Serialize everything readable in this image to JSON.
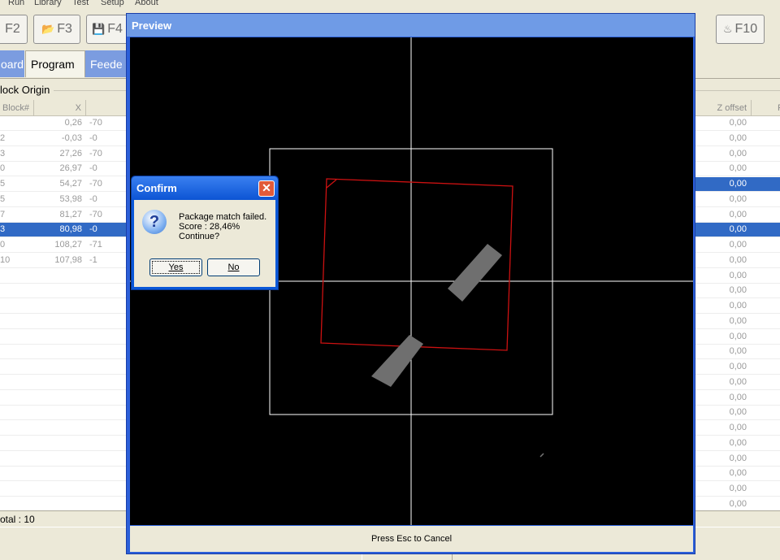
{
  "menu": [
    "Run",
    "Library",
    "Test",
    "Setup",
    "About"
  ],
  "toolbar": {
    "f2": "F2",
    "f3": "F3",
    "f4": "F4",
    "f10": "F10"
  },
  "tabs": {
    "board": "oard",
    "program": "Program",
    "feeder": "Feede"
  },
  "group_label": "lock Origin",
  "table": {
    "headers": {
      "block": "Block#",
      "x": "X",
      "z_offset": "Z offset",
      "r": "Ro"
    },
    "rows": [
      {
        "block": "",
        "x": "0,26",
        "y": "-70",
        "z": "0,00"
      },
      {
        "block": "2",
        "x": "-0,03",
        "y": "-0",
        "z": "0,00"
      },
      {
        "block": "3",
        "x": "27,26",
        "y": "-70",
        "z": "0,00"
      },
      {
        "block": "0",
        "x": "26,97",
        "y": "-0",
        "z": "0,00"
      },
      {
        "block": "5",
        "x": "54,27",
        "y": "-70",
        "z": "0,00"
      },
      {
        "block": "5",
        "x": "53,98",
        "y": "-0",
        "z": "0,00"
      },
      {
        "block": "7",
        "x": "81,27",
        "y": "-70",
        "z": "0,00"
      },
      {
        "block": "3",
        "x": "80,98",
        "y": "-0",
        "z": "0,00"
      },
      {
        "block": "0",
        "x": "108,27",
        "y": "-71",
        "z": "0,00"
      },
      {
        "block": "10",
        "x": "107,98",
        "y": "-1",
        "z": "0,00"
      },
      {
        "block": "",
        "x": "",
        "y": "",
        "z": "0,00"
      },
      {
        "block": "",
        "x": "",
        "y": "",
        "z": "0,00"
      },
      {
        "block": "",
        "x": "",
        "y": "",
        "z": "0,00"
      },
      {
        "block": "",
        "x": "",
        "y": "",
        "z": "0,00"
      },
      {
        "block": "",
        "x": "",
        "y": "",
        "z": "0,00"
      },
      {
        "block": "",
        "x": "",
        "y": "",
        "z": "0,00"
      },
      {
        "block": "",
        "x": "",
        "y": "",
        "z": "0,00"
      },
      {
        "block": "",
        "x": "",
        "y": "",
        "z": "0,00"
      },
      {
        "block": "",
        "x": "",
        "y": "",
        "z": "0,00"
      },
      {
        "block": "",
        "x": "",
        "y": "",
        "z": "0,00"
      },
      {
        "block": "",
        "x": "",
        "y": "",
        "z": "0,00"
      },
      {
        "block": "",
        "x": "",
        "y": "",
        "z": "0,00"
      },
      {
        "block": "",
        "x": "",
        "y": "",
        "z": "0,00"
      },
      {
        "block": "",
        "x": "",
        "y": "",
        "z": "0,00"
      },
      {
        "block": "",
        "x": "",
        "y": "",
        "z": "0,00"
      },
      {
        "block": "",
        "x": "",
        "y": "",
        "z": "0,00"
      }
    ]
  },
  "status": {
    "total": "otal :  10"
  },
  "preview": {
    "title": "Preview",
    "footer": "Press Esc to Cancel"
  },
  "confirm": {
    "title": "Confirm",
    "line1": "Package match failed.",
    "line2": "Score : 28,46%",
    "line3": "Continue?",
    "yes": "Yes",
    "no": "No"
  },
  "colors": {
    "selection": "#316ac5",
    "package_outline": "#cc1111",
    "preview_bg": "#000000"
  }
}
